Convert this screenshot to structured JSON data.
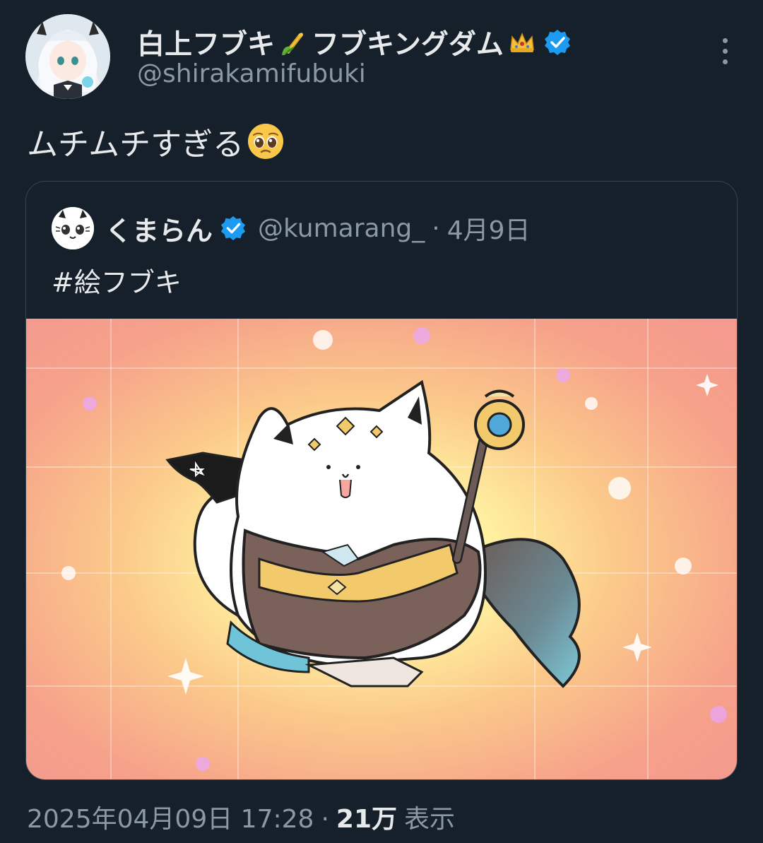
{
  "author": {
    "display_name_part1": "白上フブキ",
    "display_name_part2": "フブキングダム",
    "name_emojis": [
      "corn-emoji",
      "crown-emoji"
    ],
    "handle": "@shirakamifubuki",
    "verified": true
  },
  "tweet": {
    "text": "ムチムチすぎる",
    "emoji": "pleading-face-emoji"
  },
  "quoted_tweet": {
    "display_name": "くまらん",
    "handle": "@kumarang_",
    "separator": "·",
    "date": "4月9日",
    "text": "#絵フブキ",
    "verified": true
  },
  "meta": {
    "timestamp": "2025年04月09日 17:28",
    "separator": "·",
    "views_count": "21万",
    "views_label": "表示"
  },
  "colors": {
    "background": "#15202b",
    "verified_badge": "#1d9bf0",
    "secondary_text": "#8b98a5",
    "primary_text": "#e7e9ea"
  }
}
